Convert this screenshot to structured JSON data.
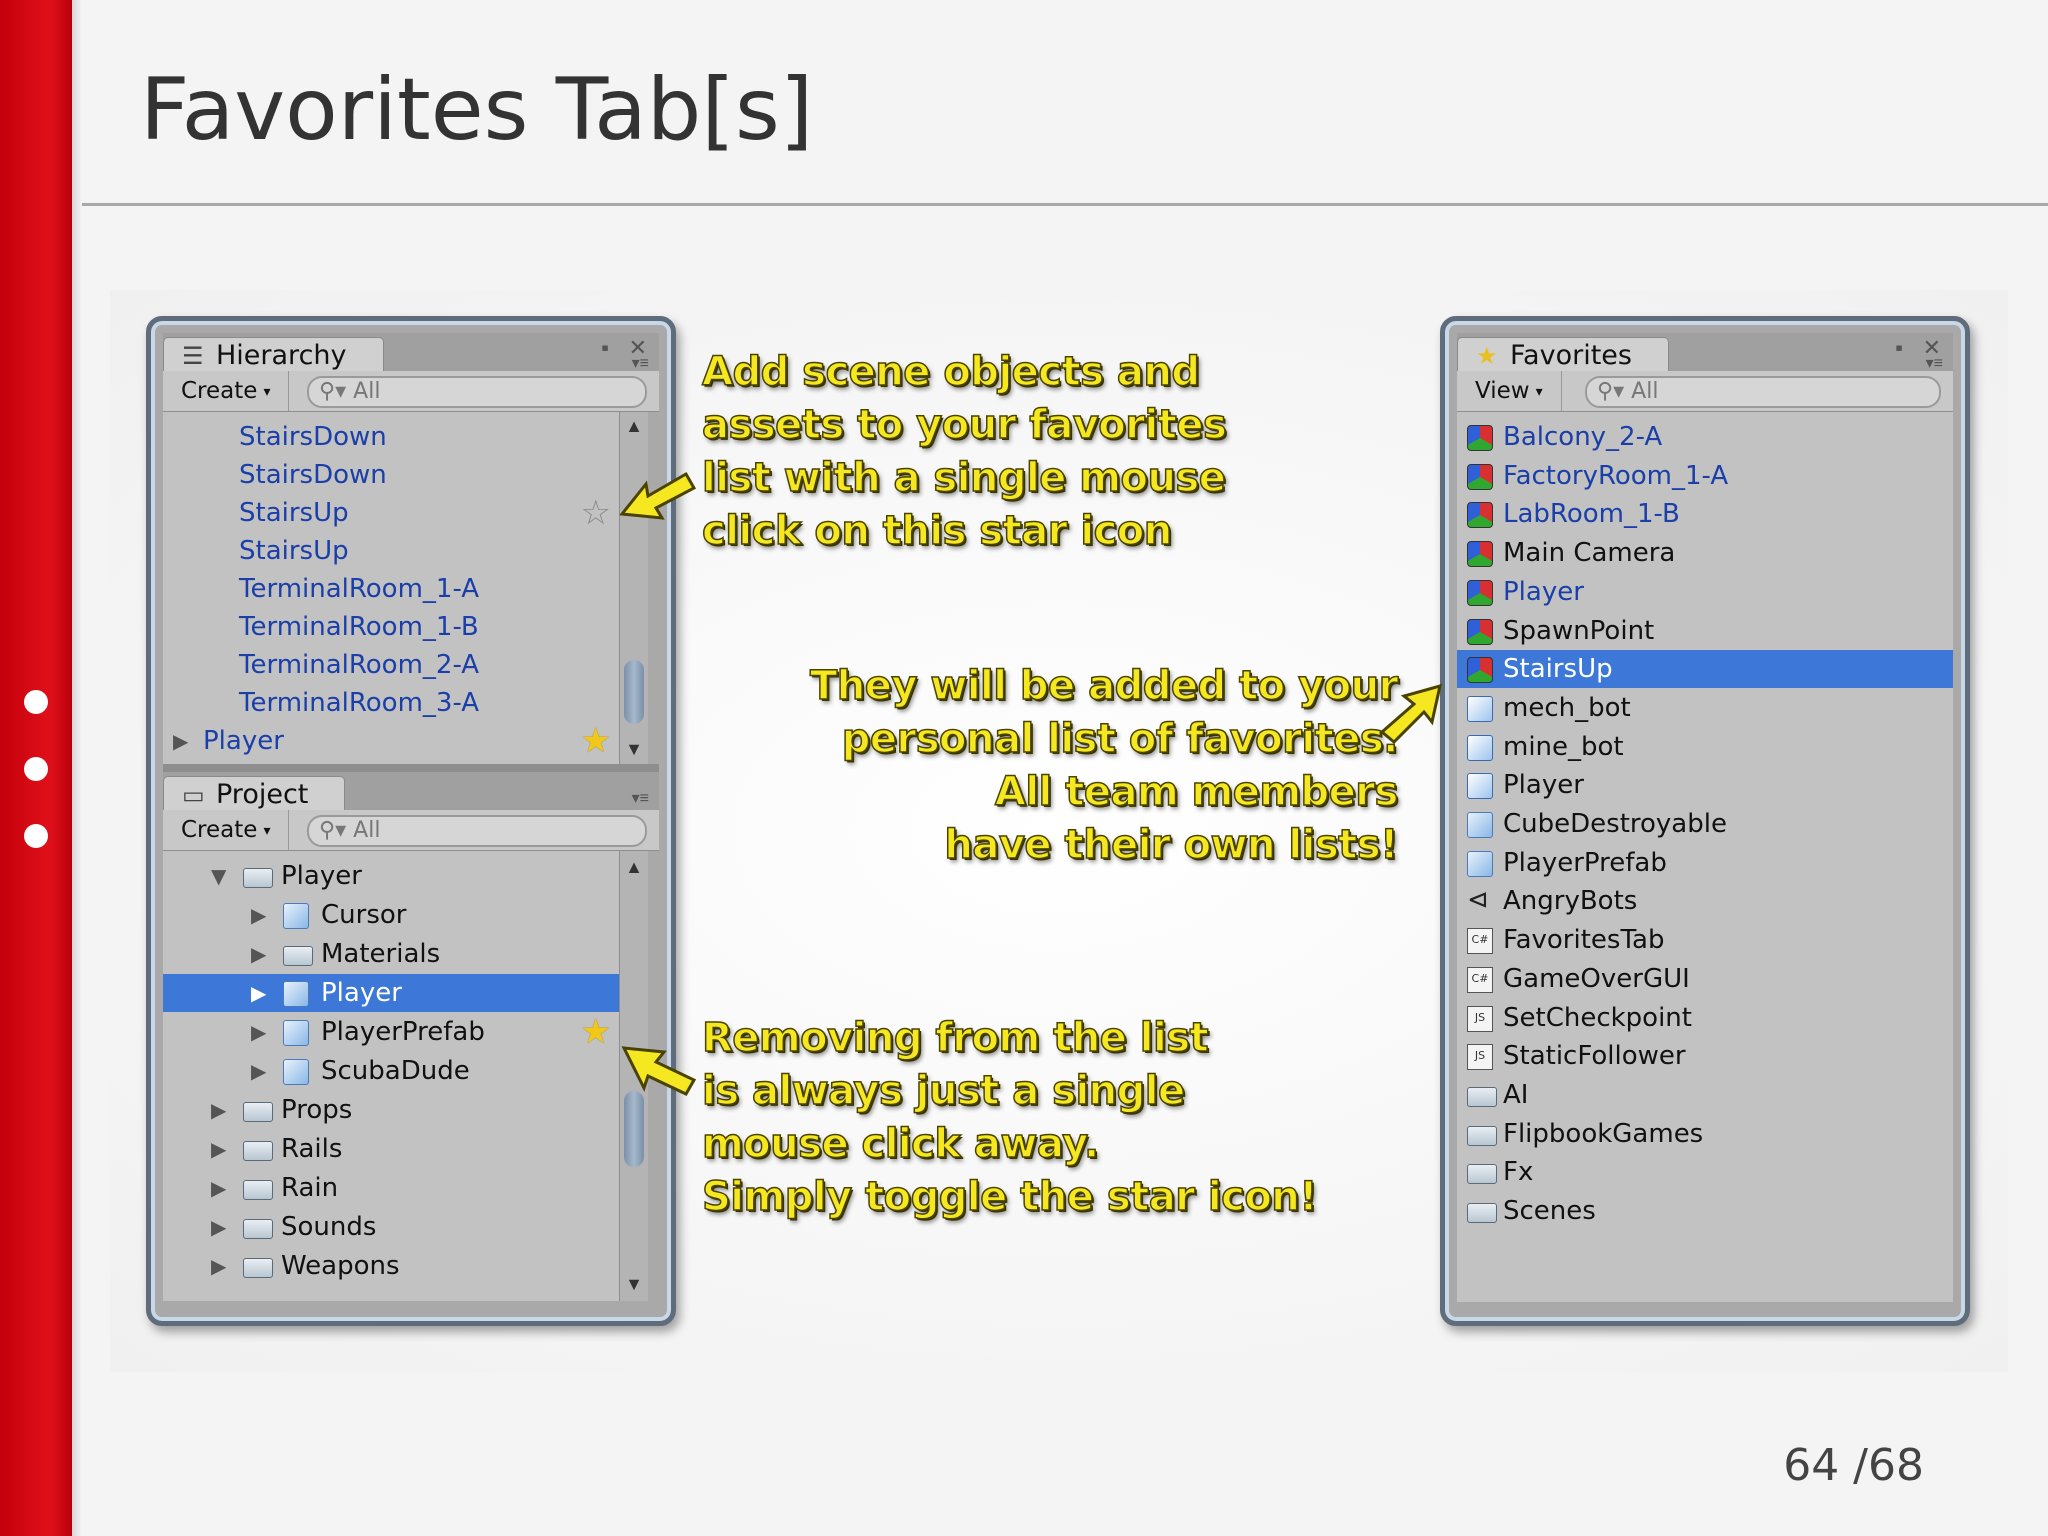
{
  "slide": {
    "title": "Favorites Tab[s]",
    "page_number": "64 /68"
  },
  "hierarchy": {
    "tab_label": "Hierarchy",
    "create_label": "Create",
    "search_placeholder": "All",
    "items": [
      {
        "label": "StairsDown",
        "starred": false
      },
      {
        "label": "StairsDown",
        "starred": false
      },
      {
        "label": "StairsUp",
        "starred": false,
        "star_hover": true
      },
      {
        "label": "StairsUp",
        "starred": false
      },
      {
        "label": "TerminalRoom_1-A",
        "starred": false
      },
      {
        "label": "TerminalRoom_1-B",
        "starred": false
      },
      {
        "label": "TerminalRoom_2-A",
        "starred": false
      },
      {
        "label": "TerminalRoom_3-A",
        "starred": false
      },
      {
        "label": "Player",
        "starred": true
      }
    ]
  },
  "project": {
    "tab_label": "Project",
    "create_label": "Create",
    "search_placeholder": "All",
    "items": [
      {
        "label": "Player",
        "type": "folder",
        "expanded": true
      },
      {
        "label": "Cursor",
        "type": "prefab"
      },
      {
        "label": "Materials",
        "type": "folder"
      },
      {
        "label": "Player",
        "type": "prefab",
        "selected": true
      },
      {
        "label": "PlayerPrefab",
        "type": "prefab",
        "starred": true
      },
      {
        "label": "ScubaDude",
        "type": "prefab"
      },
      {
        "label": "Props",
        "type": "folder"
      },
      {
        "label": "Rails",
        "type": "folder"
      },
      {
        "label": "Rain",
        "type": "folder"
      },
      {
        "label": "Sounds",
        "type": "folder"
      },
      {
        "label": "Weapons",
        "type": "folder"
      }
    ]
  },
  "favorites": {
    "tab_label": "Favorites",
    "view_label": "View",
    "search_placeholder": "All",
    "items": [
      {
        "label": "Balcony_2-A",
        "icon": "gameobject-icon",
        "blue": true
      },
      {
        "label": "FactoryRoom_1-A",
        "icon": "gameobject-icon",
        "blue": true
      },
      {
        "label": "LabRoom_1-B",
        "icon": "gameobject-icon",
        "blue": true
      },
      {
        "label": "Main Camera",
        "icon": "gameobject-icon"
      },
      {
        "label": "Player",
        "icon": "gameobject-icon",
        "blue": true
      },
      {
        "label": "SpawnPoint",
        "icon": "gameobject-icon"
      },
      {
        "label": "StairsUp",
        "icon": "gameobject-icon",
        "selected": true
      },
      {
        "label": "mech_bot",
        "icon": "model-icon"
      },
      {
        "label": "mine_bot",
        "icon": "model-icon"
      },
      {
        "label": "Player",
        "icon": "model-icon"
      },
      {
        "label": "CubeDestroyable",
        "icon": "prefab-icon"
      },
      {
        "label": "PlayerPrefab",
        "icon": "prefab-icon"
      },
      {
        "label": "AngryBots",
        "icon": "unity-scene-icon"
      },
      {
        "label": "FavoritesTab",
        "icon": "cs-script-icon"
      },
      {
        "label": "GameOverGUI",
        "icon": "cs-script-icon"
      },
      {
        "label": "SetCheckpoint",
        "icon": "js-script-icon"
      },
      {
        "label": "StaticFollower",
        "icon": "js-script-icon"
      },
      {
        "label": "AI",
        "icon": "folder-icon"
      },
      {
        "label": "FlipbookGames",
        "icon": "folder-icon"
      },
      {
        "label": "Fx",
        "icon": "folder-icon"
      },
      {
        "label": "Scenes",
        "icon": "folder-icon"
      }
    ]
  },
  "callouts": {
    "add": [
      "Add scene objects and",
      "assets to your favorites",
      "list with a single mouse",
      "click on this star icon"
    ],
    "added": [
      "They will be added to your",
      "personal list of favorites.",
      "All team members",
      "have their own lists!"
    ],
    "remove": [
      "Removing from the list",
      "is always just a single",
      "mouse click away.",
      "Simply toggle the star icon!"
    ]
  },
  "colors": {
    "accent_red": "#d8101a",
    "selection_blue": "#3d78d9",
    "callout_yellow": "#f5e820",
    "star_gold": "#f2c818"
  }
}
